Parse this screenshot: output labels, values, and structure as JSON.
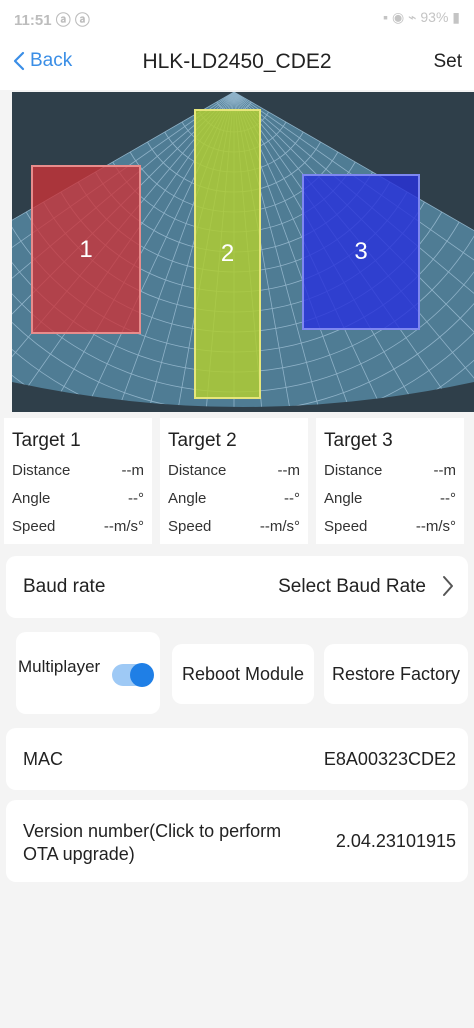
{
  "status_bar": {
    "time": "11:51 ⓐ ⓐ",
    "indicators": "▪ ◉ ⌁ 93% ▮"
  },
  "nav": {
    "back_label": "Back",
    "title": "HLK-LD2450_CDE2",
    "set_label": "Set"
  },
  "radar": {
    "background_color": "#2f3f4a",
    "grid_color": "#8fb2c8",
    "targets": [
      {
        "label": "1",
        "color": "#cd3237"
      },
      {
        "label": "2",
        "color": "#afcd32"
      },
      {
        "label": "3",
        "color": "#2832dc"
      }
    ]
  },
  "target_stats": [
    {
      "title": "Target 1",
      "distance_label": "Distance",
      "distance_value": "--m",
      "angle_label": "Angle",
      "angle_value": "--°",
      "speed_label": "Speed",
      "speed_value": "--m/s°"
    },
    {
      "title": "Target 2",
      "distance_label": "Distance",
      "distance_value": "--m",
      "angle_label": "Angle",
      "angle_value": "--°",
      "speed_label": "Speed",
      "speed_value": "--m/s°"
    },
    {
      "title": "Target 3",
      "distance_label": "Distance",
      "distance_value": "--m",
      "angle_label": "Angle",
      "angle_value": "--°",
      "speed_label": "Speed",
      "speed_value": "--m/s°"
    }
  ],
  "baud_rate": {
    "label": "Baud rate",
    "value": "Select Baud Rate"
  },
  "multiplayer": {
    "label": "Multiplayer",
    "enabled": true,
    "accent": "#1f7fe6"
  },
  "buttons": {
    "reboot": "Reboot Module",
    "restore": "Restore Factory"
  },
  "mac": {
    "label": "MAC",
    "value": "E8A00323CDE2"
  },
  "version": {
    "label": "Version number(Click to perform OTA upgrade)",
    "value": "2.04.23101915"
  }
}
